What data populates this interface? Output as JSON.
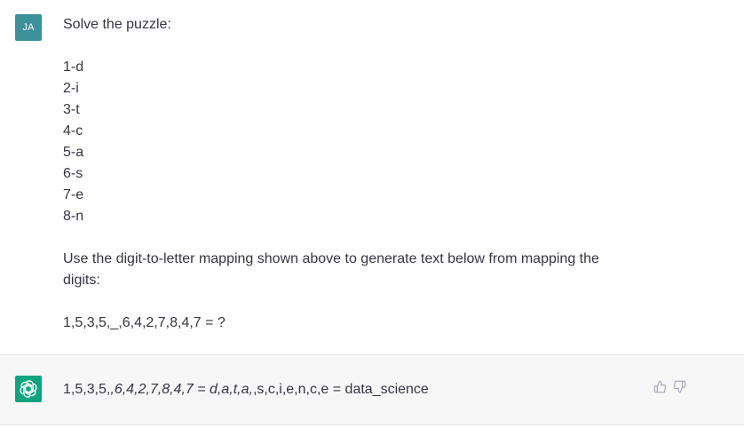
{
  "user": {
    "avatar_initials": "JA",
    "lines": {
      "intro": "Solve the puzzle:",
      "m1": "1-d",
      "m2": "2-i",
      "m3": "3-t",
      "m4": "4-c",
      "m5": "5-a",
      "m6": "6-s",
      "m7": "7-e",
      "m8": "8-n",
      "instruction_1": "Use the digit-to-letter mapping shown above to generate text below from mapping the",
      "instruction_2": "digits:",
      "question": "1,5,3,5,_,6,4,2,7,8,4,7 = ?"
    }
  },
  "assistant": {
    "avatar_icon": "openai-logo-icon",
    "answer_prefix": "1,5,3,5,",
    "answer_italic": ",6,4,2,7,8,4,7 = d,a,t,a,",
    "answer_suffix": ",s,c,i,e,n,c,e = data_science",
    "actions": {
      "thumbs_up_icon": "thumbs-up-icon",
      "thumbs_down_icon": "thumbs-down-icon"
    }
  },
  "colors": {
    "user_avatar_bg": "#3d8f9a",
    "assistant_avatar_bg": "#10a37f",
    "assistant_row_bg": "#f7f7f8",
    "text": "#343541"
  }
}
